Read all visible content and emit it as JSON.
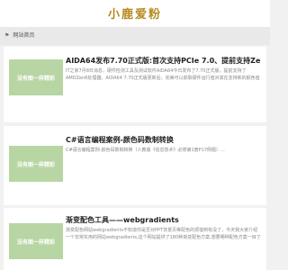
{
  "site": {
    "logo_text": "小鹿爱粉"
  },
  "breadcrumb": {
    "home_icon": "home-icon",
    "label": "网站首页"
  },
  "placeholder_image_text": "没有图一样精彩",
  "articles": [
    {
      "title": "AIDA64发布7.70正式版:首次支持PCIe 7.0、提前支持Zen 6",
      "excerpt": "IT之家7月8日消息，硬件检测工具及测试软件AIDA64今日发布了7.70正式版，提前支持了AMDZen6处理器。AIDA64 7.70正式版更新后，完美可以获取硬件运行值对其在支持新的颜色值得到读"
    },
    {
      "title": "C#语言编程案例-颜色码数制转换",
      "excerpt": "C#语言编程案例-颜色码数制转换（人教版《信息技术》必修第1册P17例题）..."
    },
    {
      "title": "渐变配色工具——webgradients",
      "excerpt": "渐变配色网站webgradients不知道你是否对PPT背景页等配色的烦恼到有没了，今天我大家介绍一个非常实用的网站webgradients,这个网站提供了180种渐变配色方案,想要哪种配色方案一目了然"
    }
  ]
}
